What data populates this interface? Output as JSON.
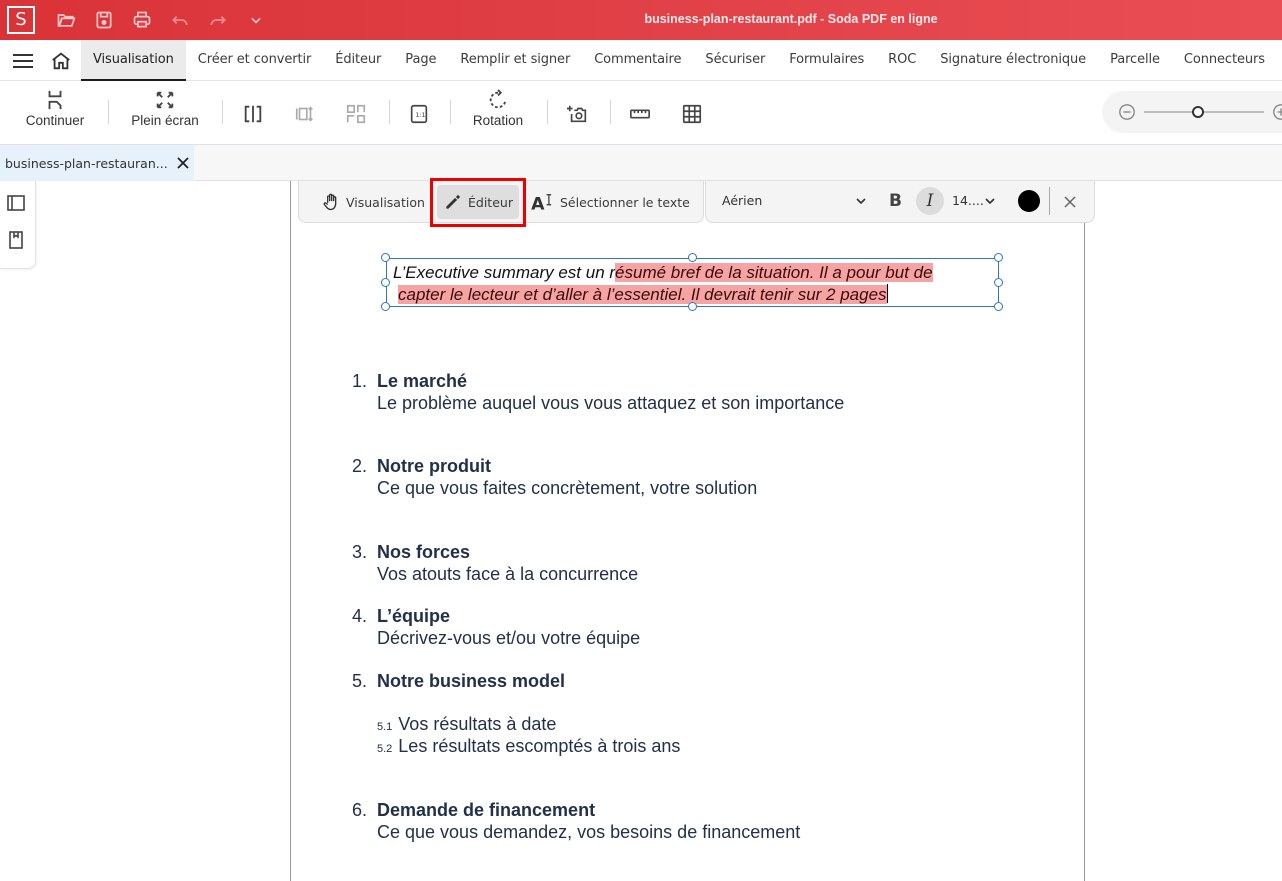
{
  "titlebar": {
    "logo": "S",
    "title": "business-plan-restaurant.pdf - Soda PDF en ligne",
    "quick_access": [
      "open-folder",
      "save",
      "print",
      "undo",
      "redo",
      "more"
    ]
  },
  "menu": {
    "tabs": [
      {
        "label": "Visualisation",
        "active": true
      },
      {
        "label": "Créer et convertir"
      },
      {
        "label": "Éditeur"
      },
      {
        "label": "Page"
      },
      {
        "label": "Remplir et signer"
      },
      {
        "label": "Commentaire"
      },
      {
        "label": "Sécuriser"
      },
      {
        "label": "Formulaires"
      },
      {
        "label": "ROC"
      },
      {
        "label": "Signature électronique"
      },
      {
        "label": "Parcelle"
      },
      {
        "label": "Connecteurs"
      }
    ]
  },
  "toolbar": {
    "continue_label": "Continuer",
    "fullscreen_label": "Plein écran",
    "rotation_label": "Rotation",
    "zoom_level_fraction": 0.45
  },
  "document_tab": {
    "name": "business-plan-restauran..."
  },
  "edit_toolbar": {
    "view_label": "Visualisation",
    "editor_label": "Éditeur",
    "select_text_label": "Sélectionner le texte",
    "active_mode": "Éditeur"
  },
  "format_toolbar": {
    "font": "Aérien",
    "bold": "B",
    "italic": "I",
    "size": "14....",
    "text_color": "#000000"
  },
  "text_box": {
    "line1_plain": "L’Executive summary est un r",
    "line1_selected": "ésumé bref de la situation. Il a pour but de ",
    "line2_selected": " capter le lecteur et d’aller à l’essentiel. Il devrait tenir sur 2 pages"
  },
  "document": {
    "items": [
      {
        "num": "1.",
        "title": "Le marché",
        "desc": "Le problème auquel vous vous attaquez et son importance"
      },
      {
        "num": "2.",
        "title": "Notre produit",
        "desc": "Ce que vous faites concrètement, votre solution"
      },
      {
        "num": "3.",
        "title": "Nos forces",
        "desc": "Vos atouts face à la concurrence"
      },
      {
        "num": "4.",
        "title": "L’équipe",
        "desc": "Décrivez-vous et/ou votre équipe"
      },
      {
        "num": "5.",
        "title": "Notre business model",
        "desc": ""
      },
      {
        "num": "6.",
        "title": "Demande de financement",
        "desc": "Ce que vous demandez, vos besoins de financement"
      }
    ],
    "subitems": [
      {
        "num": "5.1",
        "text": "Vos résultats à date"
      },
      {
        "num": "5.2",
        "text": "Les résultats escomptés à trois ans"
      }
    ]
  },
  "colors": {
    "brand_red": "#d93338",
    "selection_highlight": "#f6a3a3",
    "textbox_border": "#2f74c0",
    "annotation_box": "#ee0000"
  }
}
